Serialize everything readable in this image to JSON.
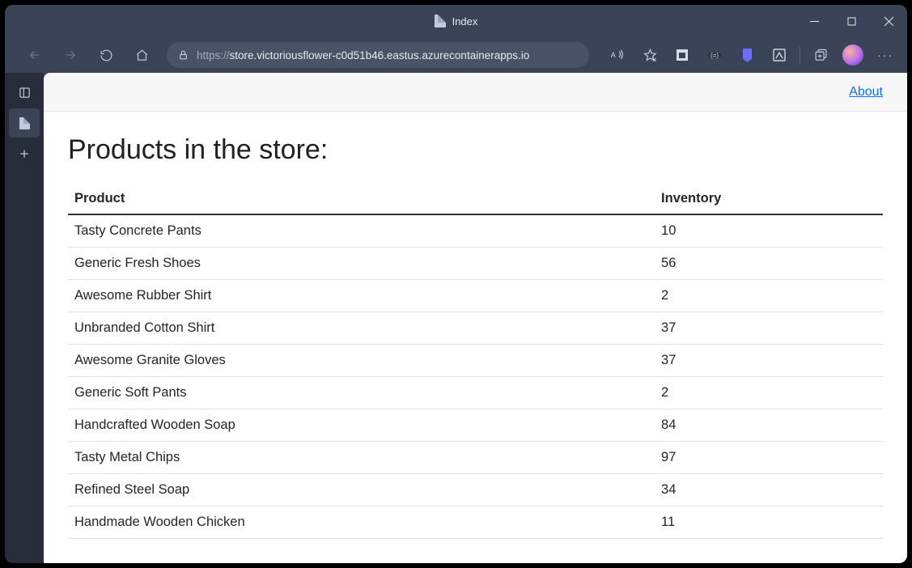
{
  "window": {
    "title": "Index"
  },
  "address": {
    "scheme": "https://",
    "host": "store.victoriousflower-c0d51b46.eastus.azurecontainerapps.io",
    "path": ""
  },
  "nav": {
    "about": "About"
  },
  "page": {
    "heading": "Products in the store:",
    "columns": {
      "product": "Product",
      "inventory": "Inventory"
    },
    "rows": [
      {
        "product": "Tasty Concrete Pants",
        "inventory": "10"
      },
      {
        "product": "Generic Fresh Shoes",
        "inventory": "56"
      },
      {
        "product": "Awesome Rubber Shirt",
        "inventory": "2"
      },
      {
        "product": "Unbranded Cotton Shirt",
        "inventory": "37"
      },
      {
        "product": "Awesome Granite Gloves",
        "inventory": "37"
      },
      {
        "product": "Generic Soft Pants",
        "inventory": "2"
      },
      {
        "product": "Handcrafted Wooden Soap",
        "inventory": "84"
      },
      {
        "product": "Tasty Metal Chips",
        "inventory": "97"
      },
      {
        "product": "Refined Steel Soap",
        "inventory": "34"
      },
      {
        "product": "Handmade Wooden Chicken",
        "inventory": "11"
      }
    ]
  }
}
